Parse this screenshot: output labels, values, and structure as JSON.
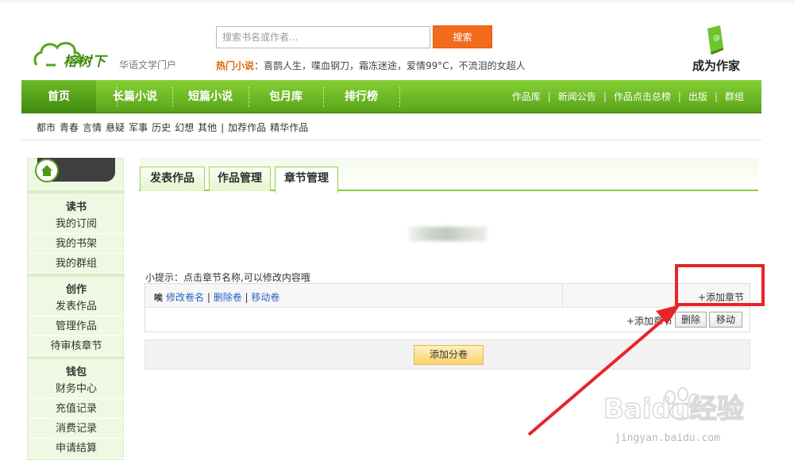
{
  "header": {
    "logo_text": "榕树下",
    "tagline": "华语文学门户",
    "search_placeholder": "搜索书名或作者...",
    "search_button": "搜索",
    "hot_label": "热门小说：",
    "hot_items": "喜鹊人生，喋血钢刀，霜冻迷途，爱情99°C，不流泪的女超人",
    "become_writer": "成为作家"
  },
  "nav": {
    "items": [
      "首页",
      "长篇小说",
      "短篇小说",
      "包月库",
      "排行榜"
    ],
    "right_links": [
      "作品库",
      "新闻公告",
      "作品点击总榜",
      "出版",
      "群组"
    ]
  },
  "subnav": [
    "都市",
    "青春",
    "言情",
    "悬疑",
    "军事",
    "历史",
    "幻想",
    "其他",
    "|",
    "加荐作品",
    "精华作品"
  ],
  "sidebar": {
    "sections": [
      {
        "title": "读书",
        "items": [
          "我的订阅",
          "我的书架",
          "我的群组"
        ]
      },
      {
        "title": "创作",
        "items": [
          "发表作品",
          "管理作品",
          "待审核章节"
        ]
      },
      {
        "title": "钱包",
        "items": [
          "财务中心",
          "充值记录",
          "消费记录",
          "申请结算"
        ]
      }
    ]
  },
  "tabs": [
    "发表作品",
    "作品管理",
    "章节管理"
  ],
  "main": {
    "tip": "小提示：点击章节名称,可以修改内容哦",
    "volume_links": [
      "修改卷名",
      "删除卷",
      "移动卷"
    ],
    "volume_icon": "唉",
    "add_chapter_top": "+添加章节",
    "add_chapter_row": "+添加章节",
    "delete_button": "删除",
    "move_button": "移动",
    "add_volume_button": "添加分卷"
  },
  "watermark": {
    "brand": "Baidu经验",
    "url": "jingyan.baidu.com"
  },
  "colors": {
    "nav_green": "#6fb928",
    "search_orange": "#f26b1d",
    "annotation_red": "#e8242a"
  }
}
